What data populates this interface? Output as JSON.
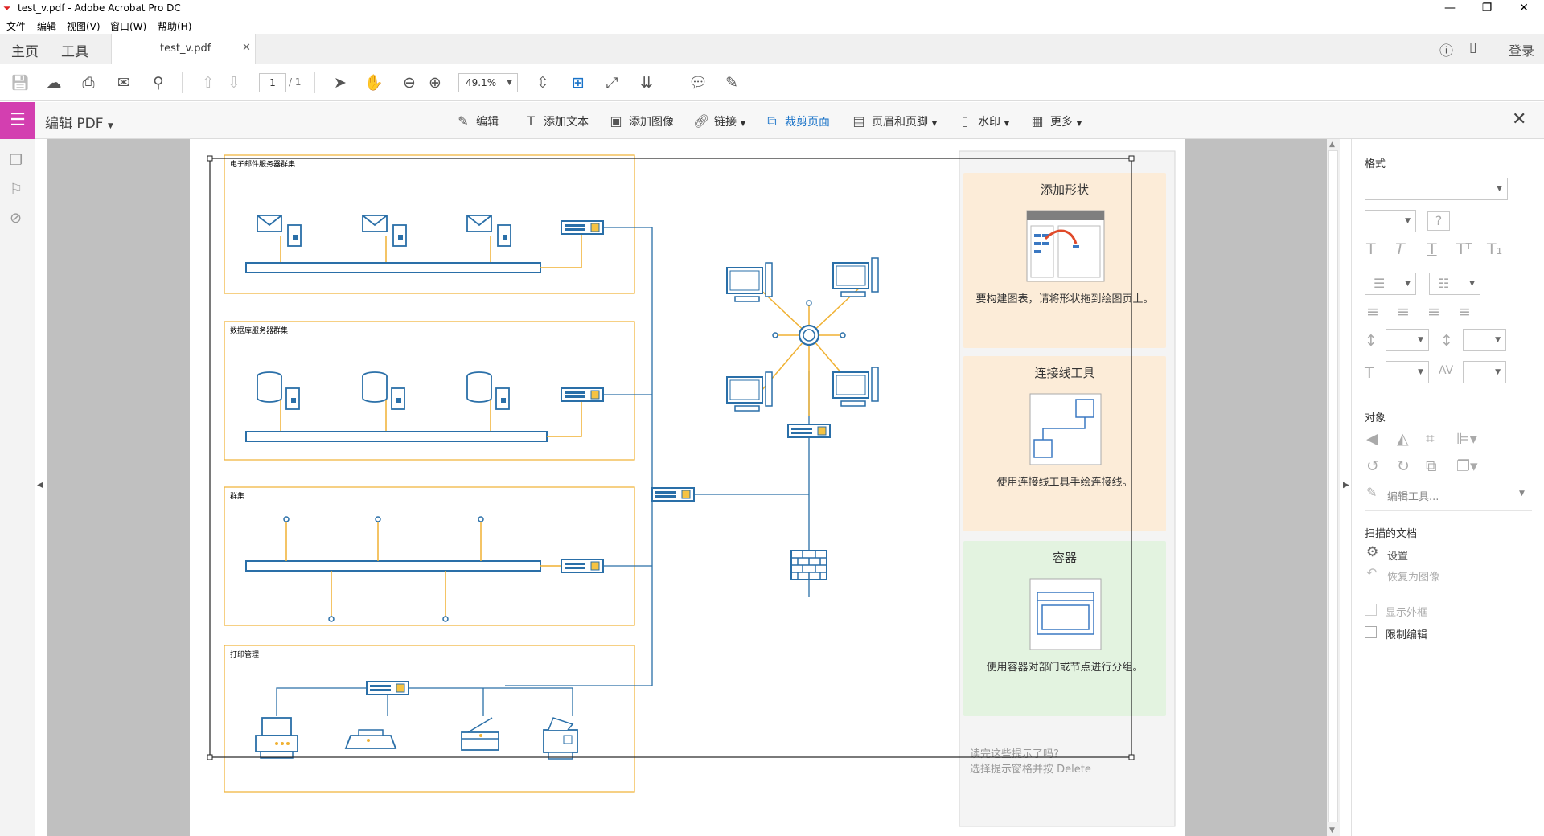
{
  "window": {
    "title": "test_v.pdf - Adobe Acrobat Pro DC"
  },
  "menu": [
    "文件",
    "编辑",
    "视图(V)",
    "窗口(W)",
    "帮助(H)"
  ],
  "tabs": {
    "home": "主页",
    "tools": "工具",
    "document": "test_v.pdf",
    "login": "登录"
  },
  "toolbar": {
    "page_current": "1",
    "page_total": "/ 1",
    "zoom": "49.1%"
  },
  "edit_toolbar": {
    "title": "编辑 PDF",
    "tools": [
      "编辑",
      "添加文本",
      "添加图像",
      "链接",
      "裁剪页面",
      "页眉和页脚",
      "水印",
      "更多"
    ],
    "active_tool": "裁剪页面"
  },
  "diagram": {
    "groups": [
      "电子邮件服务器群集",
      "数据库服务器群集",
      "群集",
      "打印管理"
    ]
  },
  "stencil": {
    "cards": [
      {
        "title": "添加形状",
        "desc": "要构建图表，请将形状拖到绘图页上。",
        "color": "#fcecd8"
      },
      {
        "title": "连接线工具",
        "desc": "使用连接线工具手绘连接线。",
        "color": "#fcecd8"
      },
      {
        "title": "容器",
        "desc": "使用容器对部门或节点进行分组。",
        "color": "#e3f3e0"
      }
    ],
    "hint_line1": "读完这些提示了吗?",
    "hint_line2": "选择提示窗格并按 Delete"
  },
  "right_panel": {
    "format_heading": "格式",
    "object_heading": "对象",
    "edit_tool": "编辑工具...",
    "scanned_heading": "扫描的文档",
    "settings": "设置",
    "restore_image": "恢复为图像",
    "show_bbox": "显示外框",
    "restrict_edit": "限制编辑"
  },
  "colors": {
    "accent": "#1a73c8",
    "edit_badge": "#d33fb0",
    "group_border": "#f0b132",
    "net_line": "#2a6fa8"
  }
}
